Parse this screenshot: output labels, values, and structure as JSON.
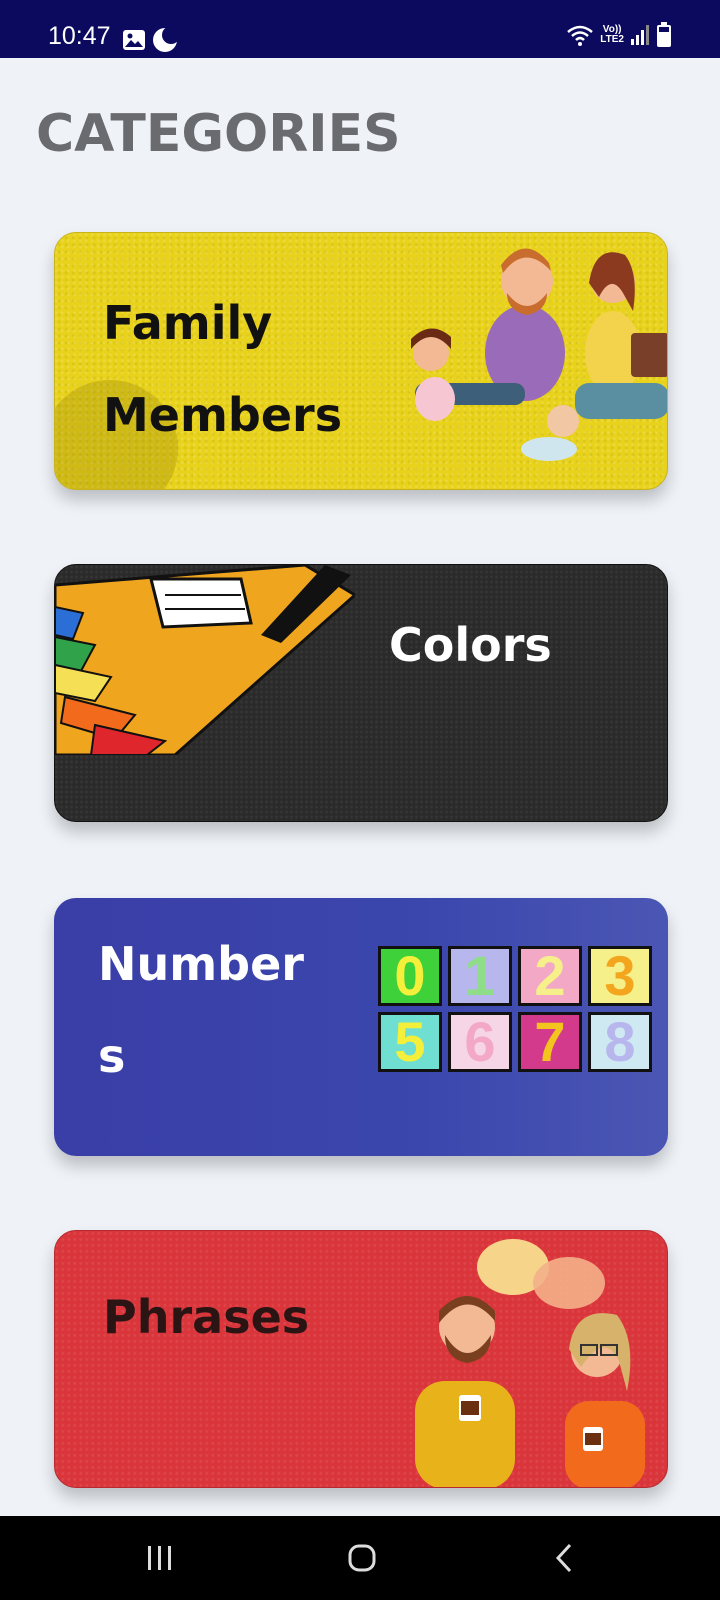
{
  "status_bar": {
    "time": "10:47",
    "network_text_top": "Vo))",
    "network_text_bottom": "LTE2"
  },
  "header": {
    "title": "CATEGORIES"
  },
  "categories": [
    {
      "label_line1": "Family",
      "label_line2": "Members",
      "color": "#e8d21b",
      "text_color": "#111111",
      "art": "family-illustration"
    },
    {
      "label_line1": "Colors",
      "label_line2": "",
      "color": "#2a2a2a",
      "text_color": "#ffffff",
      "art": "crayon-box-illustration"
    },
    {
      "label_line1": "Number",
      "label_line2": "s",
      "color": "#3a3ea7",
      "text_color": "#ffffff",
      "art": "number-blocks-illustration",
      "digits_row1": [
        "0",
        "1",
        "2",
        "3"
      ],
      "digits_row2": [
        "5",
        "6",
        "7",
        "8"
      ]
    },
    {
      "label_line1": "Phrases",
      "label_line2": "",
      "color": "#d9353b",
      "text_color": "#2a1414",
      "art": "talking-people-illustration"
    }
  ],
  "nav_bar": {
    "buttons": [
      "recent-apps",
      "home",
      "back"
    ]
  }
}
